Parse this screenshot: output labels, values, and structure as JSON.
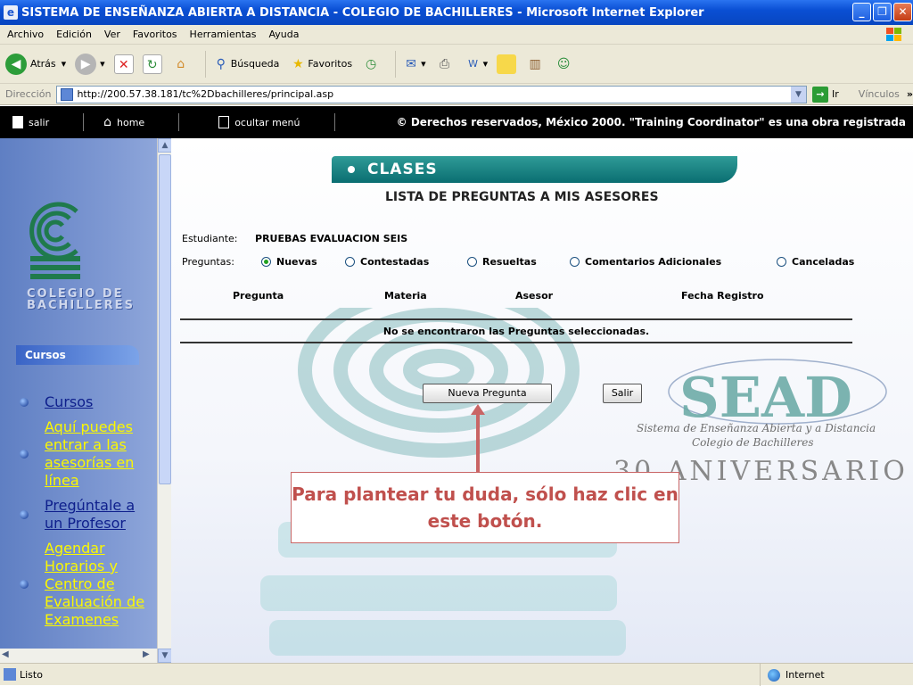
{
  "window": {
    "title": "SISTEMA DE ENSEÑANZA ABIERTA A DISTANCIA - COLEGIO DE BACHILLERES - Microsoft Internet Explorer"
  },
  "menu": [
    "Archivo",
    "Edición",
    "Ver",
    "Favoritos",
    "Herramientas",
    "Ayuda"
  ],
  "toolbar": {
    "back": "Atrás",
    "search": "Búsqueda",
    "favorites": "Favoritos"
  },
  "address": {
    "label": "Dirección",
    "url": "http://200.57.38.181/tc%2Dbachilleres/principal.asp",
    "go": "Ir",
    "links": "Vínculos"
  },
  "sitebar": {
    "salir": "salir",
    "home": "home",
    "ocultar": "ocultar menú",
    "copyright": "© Derechos reservados, México 2000. \"Training Coordinator\" es una obra registrada"
  },
  "sidebar": {
    "logo_text": [
      "COLEGIO DE",
      "BACHILLERES"
    ],
    "section": "Cursos",
    "items": [
      {
        "label": "Cursos",
        "color": "#0e1f8c"
      },
      {
        "label": "Aquí puedes entrar a las asesorías en línea",
        "color": "#fbf800"
      },
      {
        "label": "Pregúntale a un Profesor",
        "color": "#0e1f8c"
      },
      {
        "label": "Agendar Horarios y Centro de Evaluación de Examenes",
        "color": "#fbf800"
      }
    ]
  },
  "main": {
    "banner": "CLASES",
    "subtitle": "LISTA DE PREGUNTAS A MIS ASESORES",
    "student_label": "Estudiante:",
    "student_name": "PRUEBAS EVALUACION SEIS",
    "questions_label": "Preguntas:",
    "filters": [
      "Nuevas",
      "Contestadas",
      "Resueltas",
      "Comentarios Adicionales",
      "Canceladas"
    ],
    "selected_filter": "Nuevas",
    "columns": [
      "Pregunta",
      "Materia",
      "Asesor",
      "Fecha Registro"
    ],
    "empty_message": "No se encontraron las Preguntas seleccionadas.",
    "new_button": "Nueva Pregunta",
    "exit_button": "Salir",
    "callout": "Para plantear tu duda, sólo haz clic en este botón.",
    "sead": {
      "title": "SEAD",
      "line1": "Sistema de Enseñanza Abierta y a Distancia",
      "line2": "Colegio de Bachilleres",
      "line3": "30 ANIVERSARIO"
    }
  },
  "status": {
    "left": "Listo",
    "zone": "Internet"
  }
}
